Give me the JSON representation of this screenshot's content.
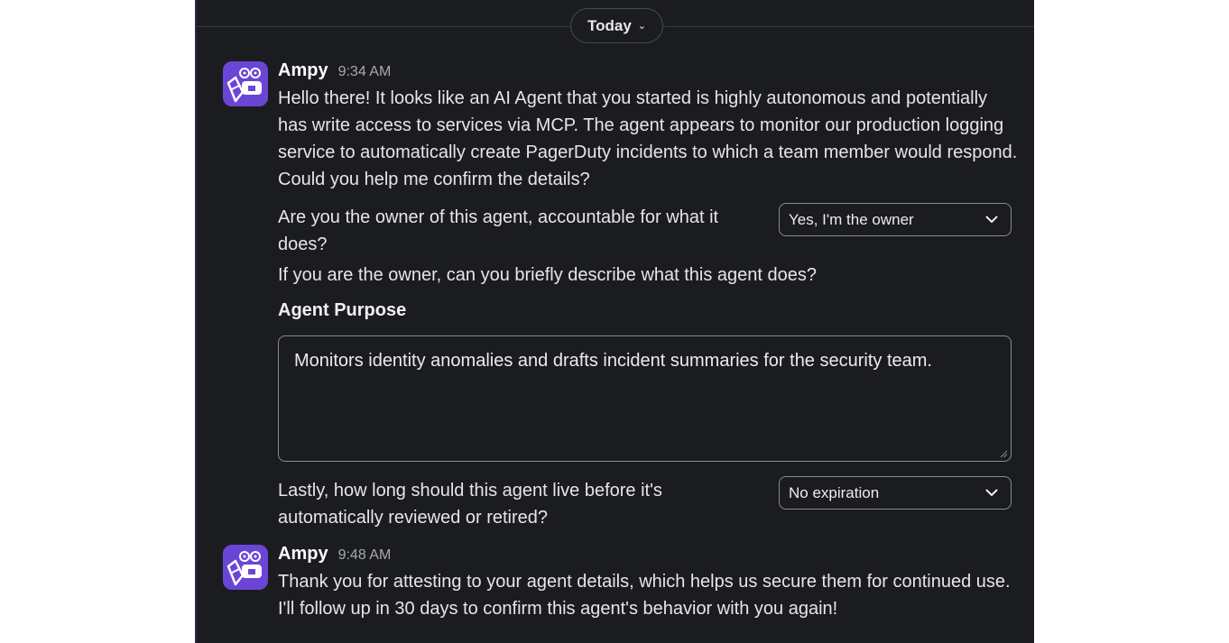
{
  "date_divider": {
    "label": "Today"
  },
  "messages": [
    {
      "sender": "Ampy",
      "time": "9:34 AM",
      "body": "Hello there! It looks like an AI Agent that you started is highly autonomous and potentially has write access to services via MCP. The agent appears to monitor our production logging service to automatically create PagerDuty incidents to which a team member would respond. Could you help me confirm the details?",
      "owner_question": "Are you the owner of this agent, accountable for what it does?",
      "owner_select": {
        "selected": "Yes, I'm the owner"
      },
      "describe_prompt": "If you are the owner, can you briefly describe what this agent does?",
      "purpose_label": "Agent Purpose",
      "purpose_value": "Monitors identity anomalies and drafts incident summaries for the security team.",
      "lifetime_question": "Lastly, how long should this agent live before it's automatically reviewed or retired?",
      "lifetime_select": {
        "selected": "No expiration"
      }
    },
    {
      "sender": "Ampy",
      "time": "9:48 AM",
      "body": "Thank you for attesting to your agent details, which helps us secure them for continued use. I'll follow up in 30 days to confirm this agent's behavior with you again!"
    }
  ],
  "colors": {
    "panel_bg": "#1b1c1f",
    "avatar_bg": "#6b45d6",
    "text": "#e6e6e8",
    "muted": "#a9aaad"
  },
  "icons": {
    "avatar": "ampy-bot-avatar-icon",
    "date_chevron": "chevron-down-icon",
    "select_chevron": "chevron-down-icon",
    "resize": "resize-grip-icon"
  }
}
